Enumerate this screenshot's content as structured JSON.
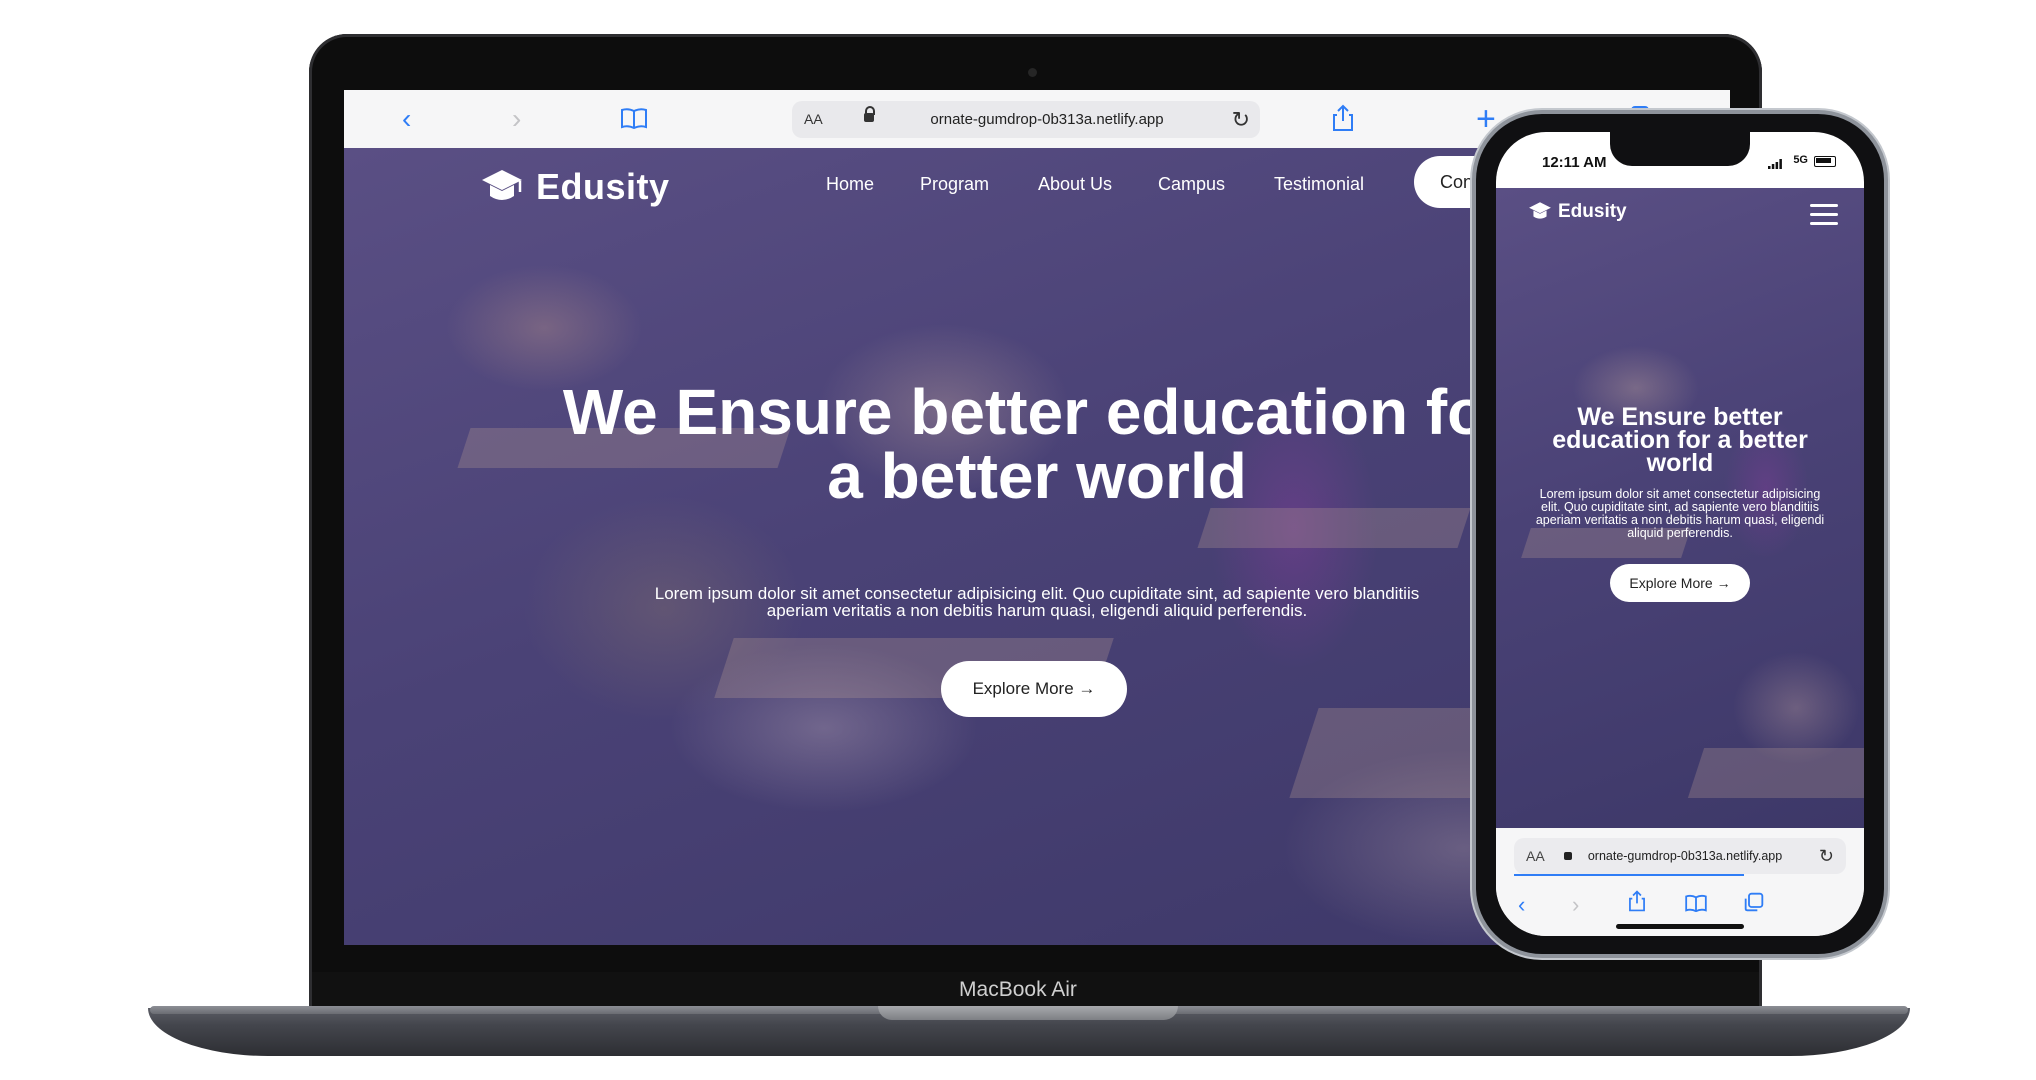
{
  "laptop": {
    "model_label": "MacBook Air",
    "browser": {
      "aa_label": "AA",
      "url": "ornate-gumdrop-0b313a.netlify.app",
      "icons": [
        "back-icon",
        "forward-icon",
        "bookmarks-icon",
        "lock-icon",
        "reload-icon",
        "share-icon",
        "new-tab-icon",
        "tabs-icon"
      ]
    },
    "site": {
      "logo_text": "Edusity",
      "nav": [
        "Home",
        "Program",
        "About Us",
        "Campus",
        "Testimonial"
      ],
      "contact_label": "Conta",
      "hero_title": "We Ensure better education for a better world",
      "hero_text": "Lorem ipsum dolor sit amet consectetur adipisicing elit. Quo cupiditate sint, ad sapiente vero blanditiis aperiam veritatis a non debitis harum quasi, eligendi aliquid perferendis.",
      "explore_label": "Explore More →"
    }
  },
  "phone": {
    "time": "12:11 AM",
    "signal": "5G",
    "site": {
      "logo_text": "Edusity",
      "hero_title": "We Ensure better education for a better world",
      "hero_text": "Lorem ipsum dolor sit amet consectetur adipisicing elit. Quo cupiditate sint, ad sapiente vero blanditiis aperiam veritatis a non debitis harum quasi, eligendi aliquid perferendis.",
      "explore_label": "Explore More →"
    },
    "browser": {
      "aa_label": "AA",
      "url": "ornate-gumdrop-0b313a.netlify.app"
    }
  },
  "colors": {
    "hero_overlay": "#4a4276",
    "safari_blue": "#2f7df6"
  }
}
